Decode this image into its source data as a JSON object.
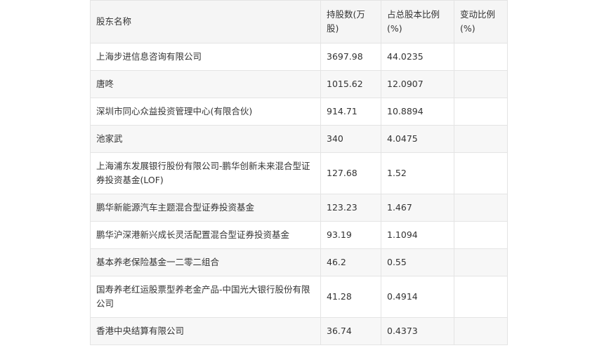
{
  "table": {
    "headers": [
      "股东名称",
      "持股数(万股)",
      "占总股本比例(%)",
      "变动比例(%)"
    ],
    "rows": [
      [
        "上海步进信息咨询有限公司",
        "3697.98",
        "44.0235",
        ""
      ],
      [
        "唐咚",
        "1015.62",
        "12.0907",
        ""
      ],
      [
        "深圳市同心众益投资管理中心(有限合伙)",
        "914.71",
        "10.8894",
        ""
      ],
      [
        "池家武",
        "340",
        "4.0475",
        ""
      ],
      [
        "上海浦东发展银行股份有限公司-鹏华创新未来混合型证券投资基金(LOF)",
        "127.68",
        "1.52",
        ""
      ],
      [
        "鹏华新能源汽车主题混合型证券投资基金",
        "123.23",
        "1.467",
        ""
      ],
      [
        "鹏华沪深港新兴成长灵活配置混合型证券投资基金",
        "93.19",
        "1.1094",
        ""
      ],
      [
        "基本养老保险基金一二零二组合",
        "46.2",
        "0.55",
        ""
      ],
      [
        "国寿养老红运股票型养老金产品-中国光大银行股份有限公司",
        "41.28",
        "0.4914",
        ""
      ],
      [
        "香港中央结算有限公司",
        "36.74",
        "0.4373",
        ""
      ]
    ]
  }
}
